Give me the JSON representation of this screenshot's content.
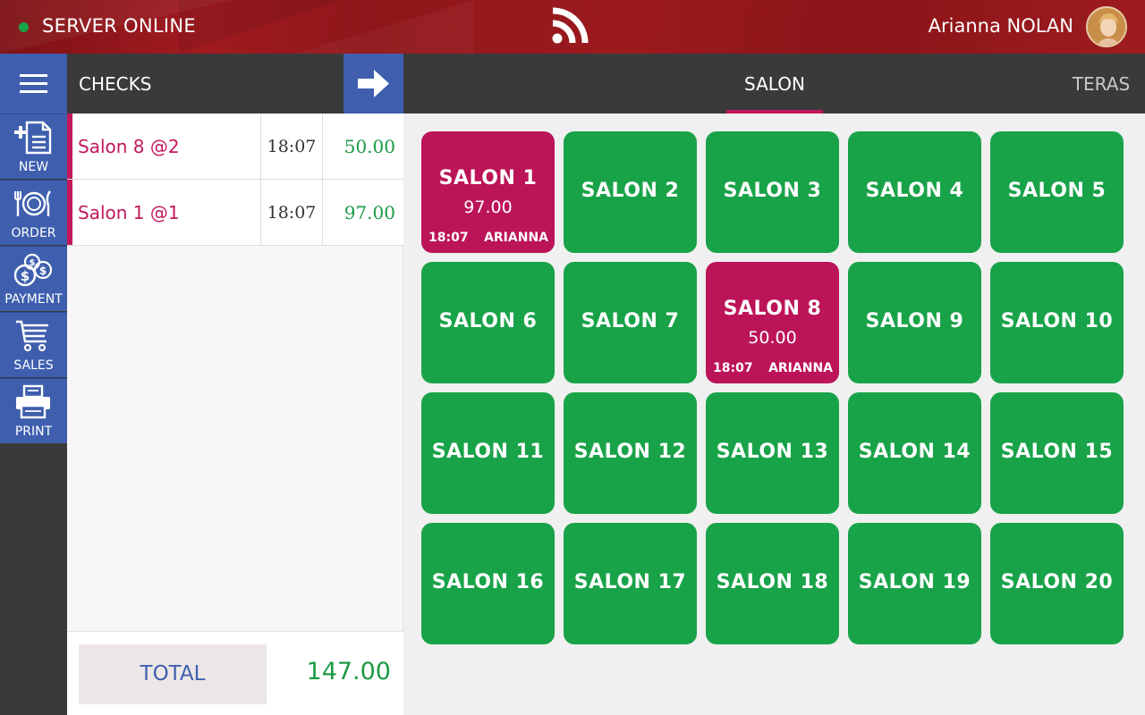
{
  "header": {
    "status_text": "SERVER ONLINE",
    "status_color": "#19a349",
    "center_icon": "rss-feed-icon",
    "user_name": "Arianna NOLAN"
  },
  "sidebar": {
    "items": [
      {
        "label": "NEW",
        "icon": "new-check-icon"
      },
      {
        "label": "ORDER",
        "icon": "plate-cutlery-icon"
      },
      {
        "label": "PAYMENT",
        "icon": "coins-icon"
      },
      {
        "label": "SALES",
        "icon": "cart-icon"
      },
      {
        "label": "PRINT",
        "icon": "printer-icon"
      }
    ]
  },
  "checks": {
    "title": "CHECKS",
    "rows": [
      {
        "name": "Salon 8 @2",
        "time": "18:07",
        "amount": "50.00"
      },
      {
        "name": "Salon 1 @1",
        "time": "18:07",
        "amount": "97.00"
      }
    ],
    "total_label": "TOTAL",
    "total_amount": "147.00"
  },
  "tabs": [
    {
      "label": "SALON",
      "active": true
    },
    {
      "label": "TERAS",
      "active": false
    }
  ],
  "tables": [
    {
      "name": "SALON 1",
      "occupied": true,
      "amount": "97.00",
      "time": "18:07",
      "user": "ARIANNA"
    },
    {
      "name": "SALON 2",
      "occupied": false
    },
    {
      "name": "SALON 3",
      "occupied": false
    },
    {
      "name": "SALON 4",
      "occupied": false
    },
    {
      "name": "SALON 5",
      "occupied": false
    },
    {
      "name": "SALON 6",
      "occupied": false
    },
    {
      "name": "SALON 7",
      "occupied": false
    },
    {
      "name": "SALON 8",
      "occupied": true,
      "amount": "50.00",
      "time": "18:07",
      "user": "ARIANNA"
    },
    {
      "name": "SALON 9",
      "occupied": false
    },
    {
      "name": "SALON 10",
      "occupied": false
    },
    {
      "name": "SALON 11",
      "occupied": false
    },
    {
      "name": "SALON 12",
      "occupied": false
    },
    {
      "name": "SALON 13",
      "occupied": false
    },
    {
      "name": "SALON 14",
      "occupied": false
    },
    {
      "name": "SALON 15",
      "occupied": false
    },
    {
      "name": "SALON 16",
      "occupied": false
    },
    {
      "name": "SALON 17",
      "occupied": false
    },
    {
      "name": "SALON 18",
      "occupied": false
    },
    {
      "name": "SALON 19",
      "occupied": false
    },
    {
      "name": "SALON 20",
      "occupied": false
    }
  ],
  "colors": {
    "free_table": "#19a349",
    "occupied_table": "#bc1458",
    "accent_blue": "#3f5fae",
    "amount_green": "#1d9a46"
  }
}
